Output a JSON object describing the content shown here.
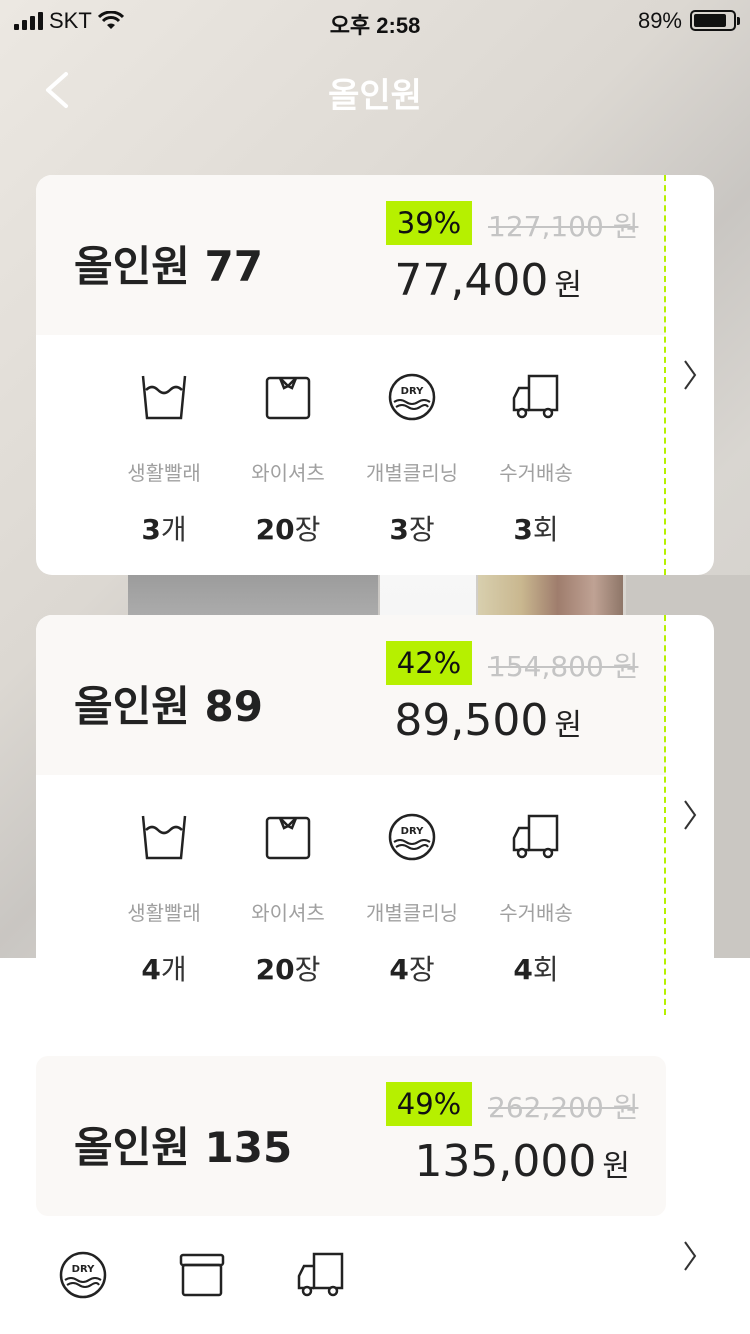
{
  "status": {
    "carrier": "SKT",
    "time": "오후 2:58",
    "battery": "89%"
  },
  "nav": {
    "title": "올인원"
  },
  "feature_labels": [
    "생활빨래",
    "와이셔츠",
    "개별클리닝",
    "수거배송"
  ],
  "dry_text": "DRY",
  "price_unit": "원",
  "cards": [
    {
      "name": "올인원 77",
      "discount": "39%",
      "original_price": "127,100 원",
      "price": "77,400",
      "features": [
        {
          "count": "3",
          "unit": "개"
        },
        {
          "count": "20",
          "unit": "장"
        },
        {
          "count": "3",
          "unit": "장"
        },
        {
          "count": "3",
          "unit": "회"
        }
      ]
    },
    {
      "name": "올인원 89",
      "discount": "42%",
      "original_price": "154,800 원",
      "price": "89,500",
      "features": [
        {
          "count": "4",
          "unit": "개"
        },
        {
          "count": "20",
          "unit": "장"
        },
        {
          "count": "4",
          "unit": "장"
        },
        {
          "count": "4",
          "unit": "회"
        }
      ]
    },
    {
      "name": "올인원 135",
      "discount": "49%",
      "original_price": "262,200 원",
      "price": "135,000"
    }
  ]
}
